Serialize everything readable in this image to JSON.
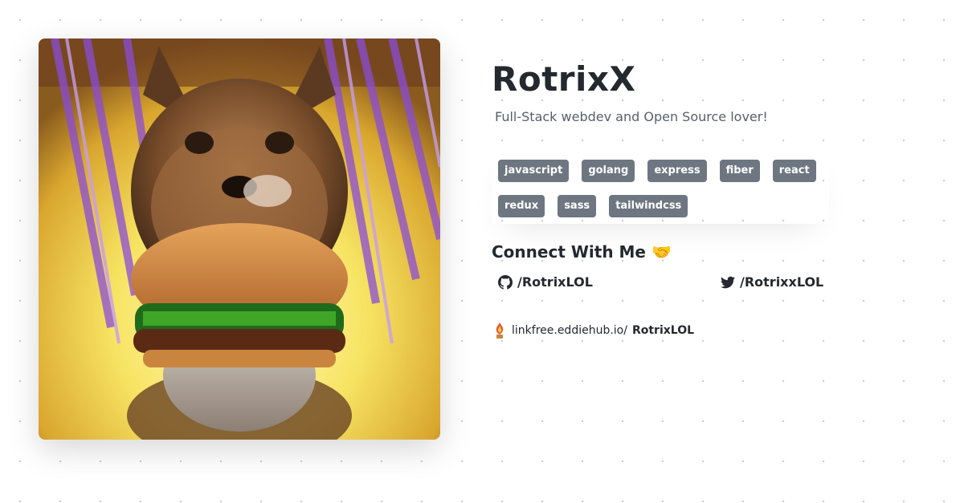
{
  "profile": {
    "name": "RotrixX",
    "tagline": "Full-Stack webdev and Open Source lover!"
  },
  "tags": [
    "javascript",
    "golang",
    "express",
    "fiber",
    "react",
    "redux",
    "sass",
    "tailwindcss"
  ],
  "connect": {
    "heading": "Connect With Me",
    "emoji": "🤝",
    "github": {
      "label": "/RotrixLOL",
      "icon": "github-icon"
    },
    "twitter": {
      "label": "/RotrixxLOL",
      "icon": "twitter-icon"
    }
  },
  "linkfree": {
    "prefix": "linkfree.eddiehub.io/",
    "username": "RotrixLOL",
    "icon": "linkfree-logo-icon"
  },
  "colors": {
    "tag_bg": "#6e7681",
    "text": "#24292f",
    "muted": "#57606a"
  }
}
